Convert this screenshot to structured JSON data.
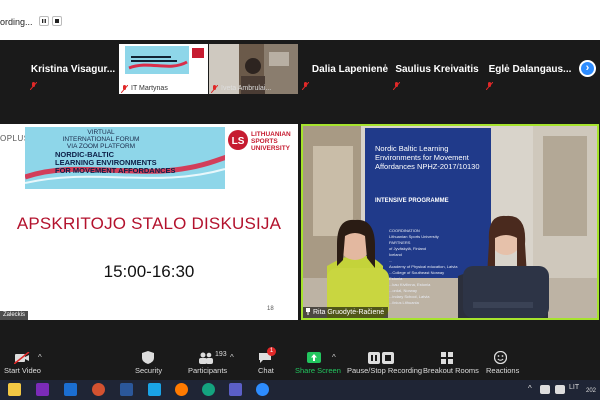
{
  "recording": {
    "label": "ording..."
  },
  "participants": [
    {
      "name": "Kristina  Visagur..."
    },
    {
      "name": "IT Martynas",
      "thumb": "slide"
    },
    {
      "name": "Iveta Ambrulai...",
      "thumb": "video"
    },
    {
      "name": "Dalia Lapenienė"
    },
    {
      "name": "Saulius Kreivaitis"
    },
    {
      "name": "Eglė  Dalangaus..."
    }
  ],
  "slide": {
    "logo_left": "OPLUS",
    "banner_line1": "VIRTUAL",
    "banner_line2": "INTERNATIONAL FORUM",
    "banner_line3": "VIA ZOOM PLATFORM",
    "banner_title1": "NORDIC-BALTIC",
    "banner_title2": "LEARNING ENVIRONMENTS",
    "banner_title3": "FOR MOVEMENT AFFORDANCES",
    "university1": "LITHUANIAN",
    "university2": "SPORTS",
    "university3": "UNIVERSITY",
    "title": "APSKRITOJO STALO DISKUSIJA",
    "time": "15:00-16:30",
    "page_num": "18",
    "presenter": "Zaleckis"
  },
  "video": {
    "speaker_name": "Rita Gruodytė-Račienė",
    "rollup_title": "Nordic Baltic Learning Environments for Movement Affordances NPHZ-2017/10130",
    "rollup_sub": "INTENSIVE PROGRAMME",
    "rollup_small1": "COORDINATION",
    "rollup_small2": "Lithuanian Sports University",
    "rollup_small3": "PARTNERS",
    "rollup_small4": "of Jyväskylä, Finland",
    "rollup_small5": "Iceland",
    "rollup_small6": "...",
    "rollup_small7": "Academy of Physical education, Latvia",
    "rollup_small8": "...College of Southeast Norway",
    "rollup_small9": "Estonia",
    "rollup_small10": "...kau Kivilinna, Estonia",
    "rollup_small11": "...ordal, Norway",
    "rollup_small12": "...indary School, Latvia",
    "rollup_small13": "...ilnius Lithuania"
  },
  "toolbar": {
    "start_video": "Start Video",
    "security": "Security",
    "participants": "Participants",
    "participants_count": "193",
    "chat": "Chat",
    "chat_badge": "1",
    "share_screen": "Share Screen",
    "recording": "Pause/Stop Recording",
    "breakout": "Breakout Rooms",
    "reactions": "Reactions"
  },
  "taskbar": {
    "lang": "LIT",
    "year": "202"
  },
  "colors": {
    "accent": "#2d8cff",
    "active_speaker": "#a6e32d",
    "slide_title": "#b3122d",
    "share_green": "#22c55e"
  }
}
